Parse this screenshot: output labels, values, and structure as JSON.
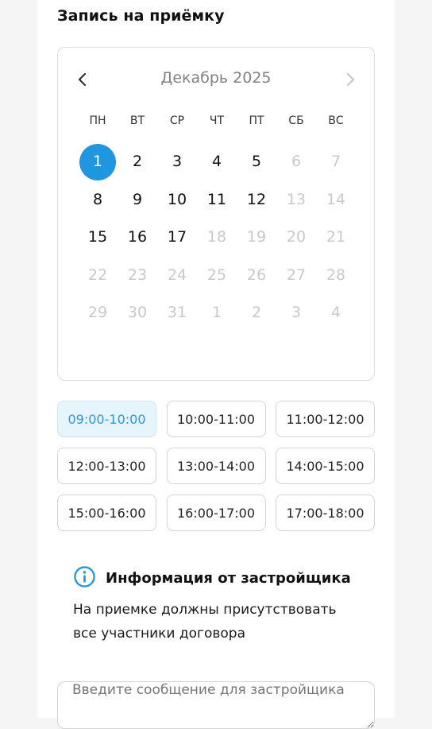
{
  "page": {
    "title": "Запись на приёмку"
  },
  "calendar": {
    "month_label": "Декабрь 2025",
    "prev_icon": "chevron-left-icon",
    "next_icon": "chevron-right-icon",
    "weekdays": [
      "ПН",
      "ВТ",
      "СР",
      "ЧТ",
      "ПТ",
      "СБ",
      "ВС"
    ],
    "weeks": [
      [
        {
          "d": "1",
          "state": "selected"
        },
        {
          "d": "2",
          "state": "available"
        },
        {
          "d": "3",
          "state": "available"
        },
        {
          "d": "4",
          "state": "available"
        },
        {
          "d": "5",
          "state": "available"
        },
        {
          "d": "6",
          "state": "disabled"
        },
        {
          "d": "7",
          "state": "disabled"
        }
      ],
      [
        {
          "d": "8",
          "state": "available"
        },
        {
          "d": "9",
          "state": "available"
        },
        {
          "d": "10",
          "state": "available"
        },
        {
          "d": "11",
          "state": "available"
        },
        {
          "d": "12",
          "state": "available"
        },
        {
          "d": "13",
          "state": "disabled"
        },
        {
          "d": "14",
          "state": "disabled"
        }
      ],
      [
        {
          "d": "15",
          "state": "available"
        },
        {
          "d": "16",
          "state": "available"
        },
        {
          "d": "17",
          "state": "available"
        },
        {
          "d": "18",
          "state": "disabled"
        },
        {
          "d": "19",
          "state": "disabled"
        },
        {
          "d": "20",
          "state": "disabled"
        },
        {
          "d": "21",
          "state": "disabled"
        }
      ],
      [
        {
          "d": "22",
          "state": "disabled"
        },
        {
          "d": "23",
          "state": "disabled"
        },
        {
          "d": "24",
          "state": "disabled"
        },
        {
          "d": "25",
          "state": "disabled"
        },
        {
          "d": "26",
          "state": "disabled"
        },
        {
          "d": "27",
          "state": "disabled"
        },
        {
          "d": "28",
          "state": "disabled"
        }
      ],
      [
        {
          "d": "29",
          "state": "disabled"
        },
        {
          "d": "30",
          "state": "disabled"
        },
        {
          "d": "31",
          "state": "disabled"
        },
        {
          "d": "1",
          "state": "disabled"
        },
        {
          "d": "2",
          "state": "disabled"
        },
        {
          "d": "3",
          "state": "disabled"
        },
        {
          "d": "4",
          "state": "disabled"
        }
      ]
    ]
  },
  "time_slots": [
    {
      "label": "09:00-10:00",
      "selected": true
    },
    {
      "label": "10:00-11:00",
      "selected": false
    },
    {
      "label": "11:00-12:00",
      "selected": false
    },
    {
      "label": "12:00-13:00",
      "selected": false
    },
    {
      "label": "13:00-14:00",
      "selected": false
    },
    {
      "label": "14:00-15:00",
      "selected": false
    },
    {
      "label": "15:00-16:00",
      "selected": false
    },
    {
      "label": "16:00-17:00",
      "selected": false
    },
    {
      "label": "17:00-18:00",
      "selected": false
    }
  ],
  "info": {
    "icon": "info-icon",
    "title": "Информация от застройщика",
    "text": "На приемке должны присутствовать все участники договора"
  },
  "message": {
    "placeholder": "Введите сообщение для застройщика",
    "value": ""
  },
  "colors": {
    "accent": "#2196e0",
    "selected_slot_bg": "#e6f4fc",
    "selected_slot_text": "#2d97dc",
    "disabled_text": "#c9c9cd",
    "border": "#d4d4d8"
  }
}
